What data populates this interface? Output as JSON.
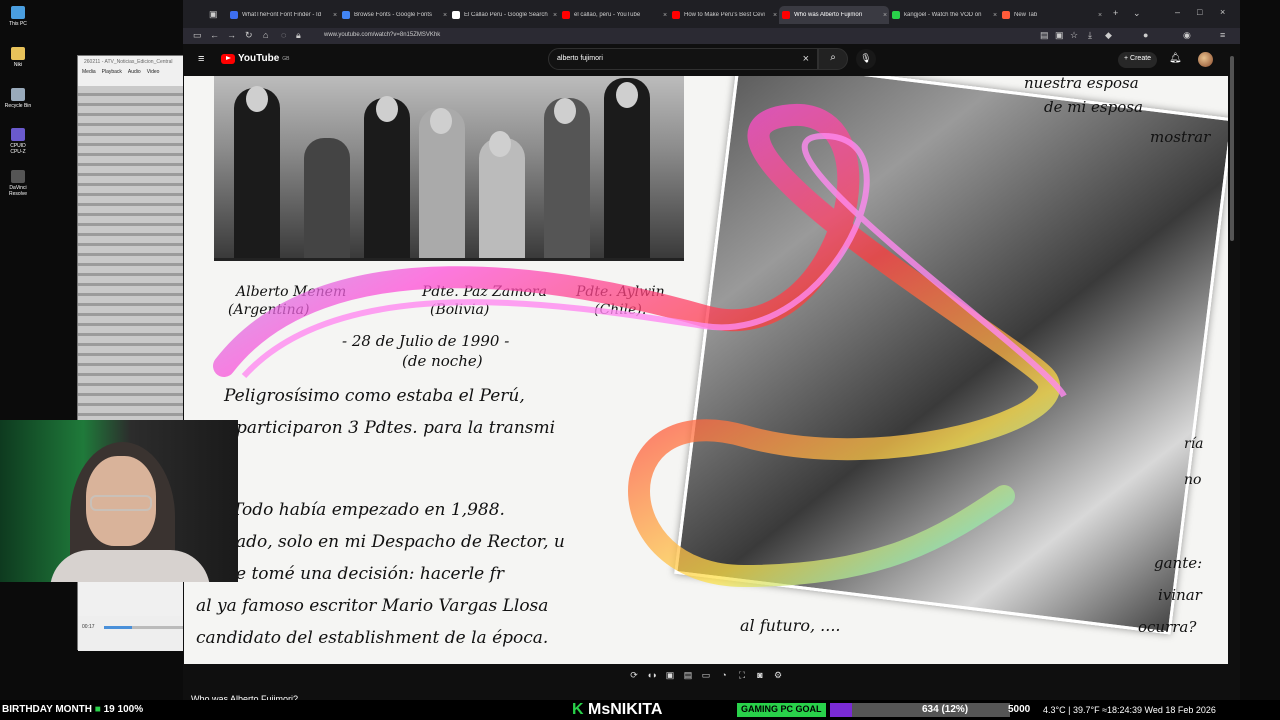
{
  "desktop": {
    "icons": [
      {
        "label": "This PC",
        "icon": "computer-icon",
        "color": "#4a9ee0"
      },
      {
        "label": "Niki",
        "icon": "folder-icon",
        "color": "#e8c25a"
      },
      {
        "label": "Recycle Bin",
        "icon": "recycle-bin-icon",
        "color": "#9ab"
      },
      {
        "label": "CPUID CPU-Z",
        "icon": "cpuz-icon",
        "color": "#6a5acd"
      },
      {
        "label": "DaVinci Resolve",
        "icon": "davinci-icon",
        "color": "#555"
      }
    ]
  },
  "vlc": {
    "title": "260211 - ATV_Noticias_Edicion_Central",
    "menu": [
      "Media",
      "Playback",
      "Audio",
      "Video"
    ],
    "time": "00:17",
    "progress": 0.35
  },
  "browser": {
    "tabs": [
      {
        "label": "WhatTheFont Font Finder - Id",
        "color": "#3d6ef0",
        "active": false
      },
      {
        "label": "Browse Fonts - Google Fonts",
        "color": "#4285f4",
        "active": false
      },
      {
        "label": "El Callao Peru - Google Search",
        "color": "#ffffff",
        "active": false
      },
      {
        "label": "el callao, peru - YouTube",
        "color": "#ff0000",
        "active": false
      },
      {
        "label": "How to Make Peru's Best Cevi",
        "color": "#ff0000",
        "active": false
      },
      {
        "label": "Who was Alberto Fujimori",
        "color": "#ff0000",
        "active": true
      },
      {
        "label": "kangjoel - Watch the VOD on",
        "color": "#29d14a",
        "active": false
      },
      {
        "label": "New Tab",
        "color": "#ff5b3a",
        "active": false
      }
    ],
    "url": "www.youtube.com/watch?v=8n15ZMSVKhk"
  },
  "youtube": {
    "logo_text": "YouTube",
    "region": "GB",
    "search_value": "alberto fujimori",
    "create_label": "Create",
    "video_title": "Who was Alberto Fujimori?"
  },
  "video_frame": {
    "letter_lines": [
      "Alberto Menem",
      "(Argentina)",
      "Pdte. Paz Zamora",
      "(Bolivia)",
      "Pdte. Aylwin",
      "(Chile).",
      "- 28 de Julio de 1990 -",
      "(de noche)",
      "Peligrosísimo como estaba el Perú,",
      "participaron 3 Pdtes. para la transmi",
      "Todo había empezado en 1,988.",
      "ado, solo en mi Despacho de Rector, u",
      "e tomé una decisión: hacerle fr",
      "al ya famoso escritor Mario Vargas Llosa",
      "candidato del establishment de la época.",
      "nuestra esposa",
      "de mi esposa",
      "mostrar",
      "al futuro, ....",
      "gante:",
      "ivinar",
      "ocurra?",
      "ría",
      "no"
    ]
  },
  "overlay": {
    "birthday": "BIRTHDAY MONTH",
    "bday_count": "19",
    "bday_pct": "100%",
    "streamer": "MsNIKITA",
    "goal_label": "GAMING PC GOAL",
    "goal_progress": "634 (12%)",
    "goal_fraction": 0.12,
    "goal_target": "5000",
    "weather": "4.3°C | 39.7°F  ≈18:24:39  Wed 18 Feb 2026"
  }
}
